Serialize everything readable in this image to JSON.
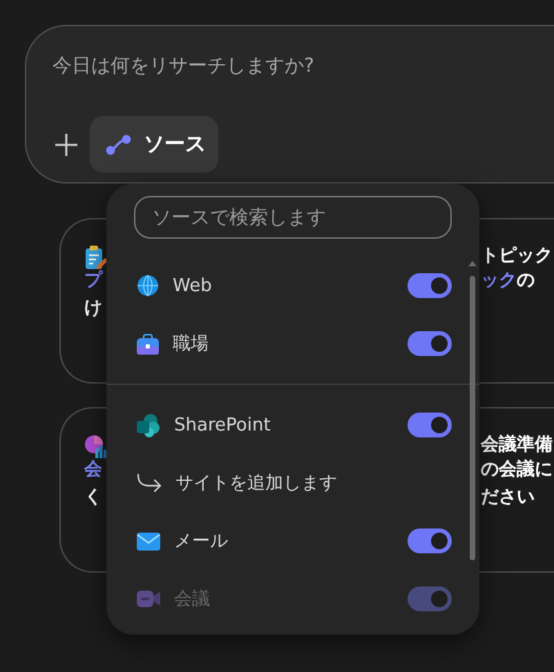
{
  "prompt": {
    "placeholder": "今日は何をリサーチしますか?"
  },
  "sources_button": {
    "label": "ソース"
  },
  "background_cards": [
    {
      "rows": [
        {
          "left": [],
          "right": [
            {
              "text": "トピック",
              "kind": "title"
            }
          ]
        },
        {
          "left": [
            {
              "text": "プ",
              "kind": "link"
            }
          ],
          "right": [
            {
              "text": "ック",
              "kind": "link"
            },
            {
              "text": " の",
              "kind": "plain"
            }
          ]
        },
        {
          "left": [
            {
              "text": "け",
              "kind": "plain"
            }
          ],
          "right": []
        }
      ]
    },
    {
      "rows": [
        {
          "left": [],
          "right": [
            {
              "text": "会議準備",
              "kind": "title"
            }
          ]
        },
        {
          "left": [
            {
              "text": "会",
              "kind": "link"
            }
          ],
          "right": [
            {
              "text": "の会議に",
              "kind": "plain"
            }
          ]
        },
        {
          "left": [
            {
              "text": "く",
              "kind": "plain"
            }
          ],
          "right": [
            {
              "text": "ださい",
              "kind": "plain"
            }
          ]
        }
      ]
    }
  ],
  "sources_menu": {
    "search": {
      "placeholder": "ソースで検索します"
    },
    "items": [
      {
        "kind": "toggle",
        "label": "Web",
        "on": true,
        "disabled": false
      },
      {
        "kind": "toggle",
        "label": "職場",
        "on": true,
        "disabled": false
      },
      {
        "kind": "divider"
      },
      {
        "kind": "toggle",
        "label": "SharePoint",
        "on": true,
        "disabled": false
      },
      {
        "kind": "action",
        "label": "サイトを追加します"
      },
      {
        "kind": "toggle",
        "label": "メール",
        "on": true,
        "disabled": false
      },
      {
        "kind": "toggle",
        "label": "会議",
        "on": true,
        "disabled": true
      }
    ]
  }
}
